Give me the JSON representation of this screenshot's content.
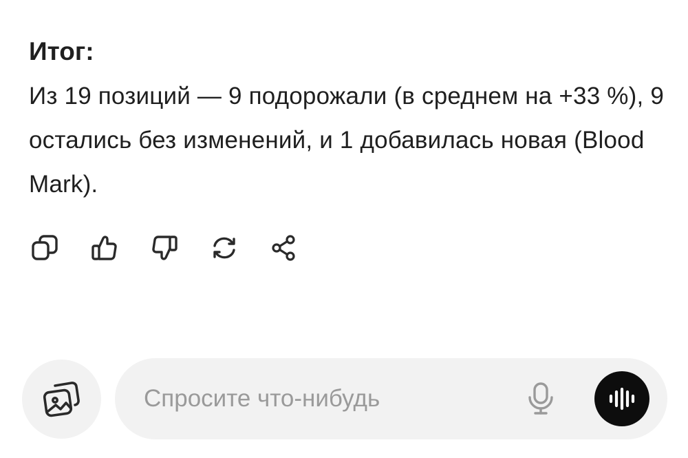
{
  "message": {
    "heading": "Итог:",
    "body": "Из 19 позиций — 9 подорожали (в среднем на +33 %), 9 остались без изменений, и 1 добавилась новая (Blood Mark)."
  },
  "actions": [
    {
      "icon": "copy-icon"
    },
    {
      "icon": "thumbs-up-icon"
    },
    {
      "icon": "thumbs-down-icon"
    },
    {
      "icon": "regenerate-icon"
    },
    {
      "icon": "share-icon"
    }
  ],
  "composer": {
    "placeholder": "Спросите что-нибудь",
    "value": "",
    "attach_icon": "image-gallery-icon",
    "mic_icon": "microphone-icon",
    "voice_icon": "voice-waveform-icon"
  },
  "colors": {
    "text": "#1f1f1f",
    "icon": "#2a2a2a",
    "pill_background": "#f2f2f2",
    "placeholder": "#9a9a9a",
    "voice_button": "#0d0d0d"
  }
}
